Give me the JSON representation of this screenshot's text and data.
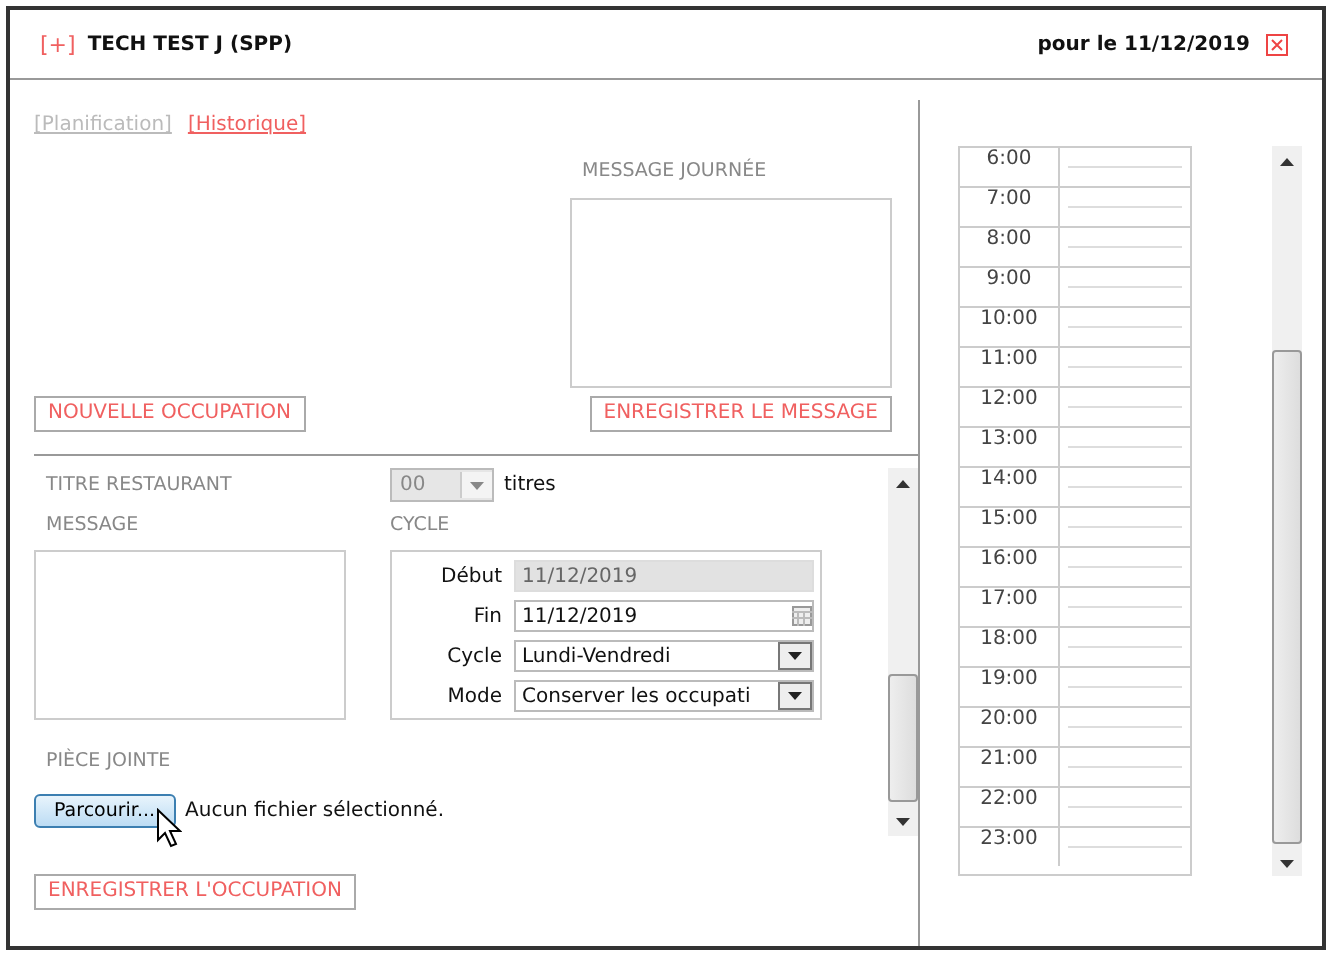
{
  "header": {
    "expand": "[+]",
    "title": "TECH TEST J (SPP)",
    "date": "pour le 11/12/2019"
  },
  "tabs": [
    {
      "label": "[Planification]",
      "selected": true
    },
    {
      "label": "[Historique]",
      "selected": false
    }
  ],
  "day_message": {
    "label": "MESSAGE JOURNÉE",
    "save_button": "ENREGISTRER LE MESSAGE"
  },
  "new_button": "NOUVELLE OCCUPATION",
  "form": {
    "meal_label": "TITRE RESTAURANT",
    "meal_count": {
      "value": "00",
      "disabled": true
    },
    "meal_unit": "titres",
    "message_label": "MESSAGE",
    "cycle_label": "CYCLE",
    "cycle_fields": [
      {
        "label": "Début",
        "value": "11/12/2019",
        "kind": "date",
        "disabled": true
      },
      {
        "label": "Fin",
        "value": "11/12/2019",
        "kind": "calendar",
        "disabled": false
      },
      {
        "label": "Cycle",
        "value": "Lundi-Vendredi",
        "kind": "select",
        "disabled": false
      },
      {
        "label": "Mode",
        "value": "Conserver les occupati",
        "kind": "select",
        "disabled": false
      }
    ],
    "attachment_label": "PIÈCE JOINTE",
    "browse_button": "Parcourir...",
    "file_status": "Aucun fichier sélectionné."
  },
  "save_button": "ENREGISTRER L'OCCUPATION",
  "hours": [
    "6:00",
    "7:00",
    "8:00",
    "9:00",
    "10:00",
    "11:00",
    "12:00",
    "13:00",
    "14:00",
    "15:00",
    "16:00",
    "17:00",
    "18:00",
    "19:00",
    "20:00",
    "21:00",
    "22:00",
    "23:00"
  ]
}
